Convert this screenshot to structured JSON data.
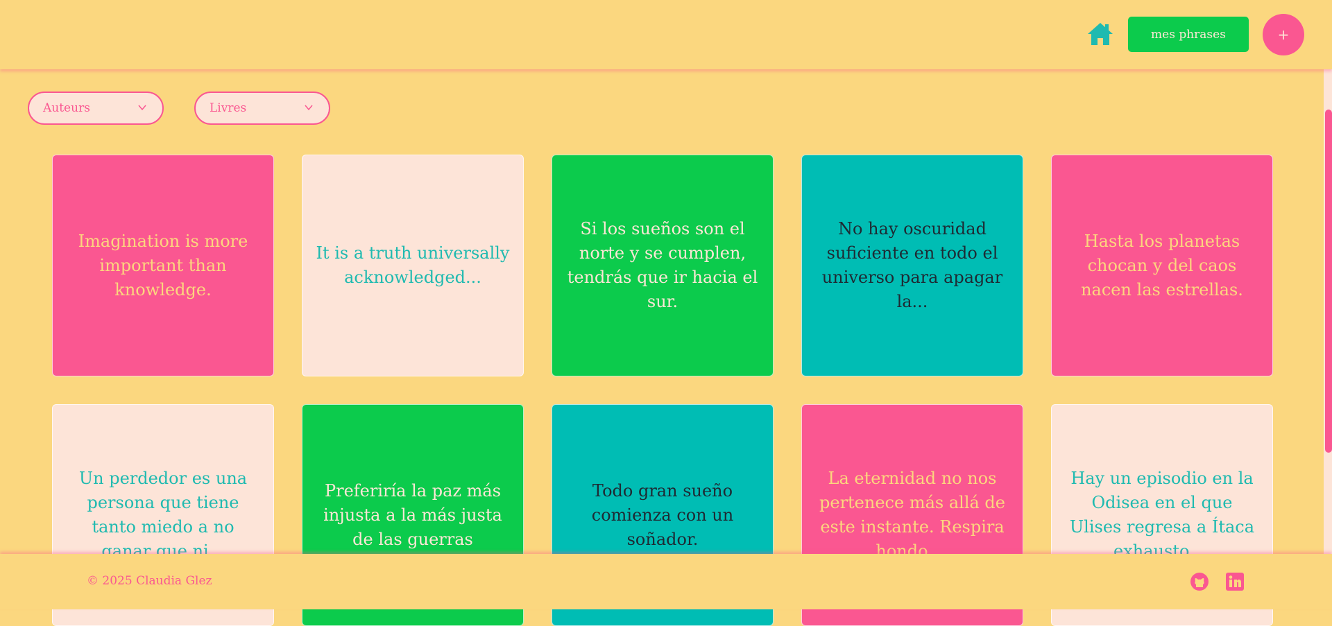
{
  "header": {
    "home_icon": "home-icon",
    "my_phrases_label": "mes phrases",
    "add_label": "+"
  },
  "filters": {
    "authors_label": "Auteurs",
    "books_label": "Livres"
  },
  "colors": {
    "background": "#fbd77f",
    "pink": "#fa5791",
    "peach": "#fde4d8",
    "green": "#0ccb4c",
    "teal": "#00bdb4"
  },
  "cards": [
    {
      "text": "Imagination is more important than knowledge.",
      "color": "pink"
    },
    {
      "text": "It is a truth universally acknowledged...",
      "color": "peach"
    },
    {
      "text": "Si los sueños son el norte y se cumplen, tendrás que ir hacia el sur.",
      "color": "green"
    },
    {
      "text": "No hay oscuridad suficiente en todo el universo para apagar la...",
      "color": "teal"
    },
    {
      "text": "Hasta los planetas chocan y del caos nacen las estrellas.",
      "color": "pink"
    },
    {
      "text": "Un perdedor es una persona que tiene tanto miedo a no ganar que ni...",
      "color": "peach"
    },
    {
      "text": "Preferiría la paz más injusta a la más justa de las guerras",
      "color": "green"
    },
    {
      "text": "Todo gran sueño comienza con un soñador.",
      "color": "teal"
    },
    {
      "text": "La eternidad no nos pertenece más allá de este instante. Respira hondo....",
      "color": "pink"
    },
    {
      "text": "Hay un episodio en la Odisea en el que Ulises regresa a Ítaca exhausto,...",
      "color": "peach"
    }
  ],
  "footer": {
    "copyright": "© 2025 Claudia Glez",
    "github_icon": "github-icon",
    "linkedin_icon": "linkedin-icon"
  }
}
